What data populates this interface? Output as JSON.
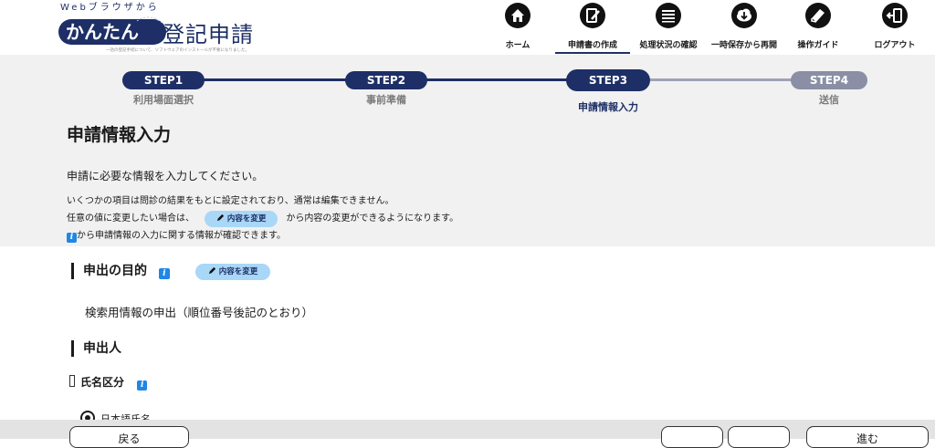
{
  "header": {
    "logo_top": "Webブラウザから",
    "logo_kantan": "かんたん",
    "logo_main": "登記申請",
    "logo_sub": "一括の登記手続について、ソフトウェアのインストールが不要になりました。",
    "nav": [
      {
        "label": "ホーム",
        "icon": "home-icon"
      },
      {
        "label": "申請書の作成",
        "icon": "edit-document-icon"
      },
      {
        "label": "処理状況の確認",
        "icon": "list-status-icon"
      },
      {
        "label": "一時保存から再開",
        "icon": "cloud-download-icon"
      },
      {
        "label": "操作ガイド",
        "icon": "guide-book-icon"
      },
      {
        "label": "ログアウト",
        "icon": "logout-icon"
      }
    ],
    "active_nav": "申請書の作成"
  },
  "steps": [
    {
      "pill": "STEP1",
      "label": "利用場面選択",
      "state": "done"
    },
    {
      "pill": "STEP2",
      "label": "事前準備",
      "state": "done"
    },
    {
      "pill": "STEP3",
      "label": "申請情報入力",
      "state": "current"
    },
    {
      "pill": "STEP4",
      "label": "送信",
      "state": "todo"
    }
  ],
  "page": {
    "title": "申請情報入力",
    "intro1": "申請に必要な情報を入力してください。",
    "intro2": "いくつかの項目は問診の結果をもとに設定されており、通常は編集できません。",
    "intro3_before": "任意の値に変更したい場合は、",
    "intro3_after": "から内容の変更ができるようになります。",
    "intro4": "から申請情報の入力に関する情報が確認できます。",
    "info_glyph": "i",
    "change_button": "内容を変更"
  },
  "sections": {
    "purpose_title": "申出の目的",
    "purpose_value": "検索用情報の申出（順位番号後記のとおり）",
    "applicant_title": "申出人",
    "name_type_label": "氏名区分",
    "radio_japanese": "日本語氏名"
  },
  "footer": {
    "back": "戻る",
    "next": "進む"
  },
  "colors": {
    "navy": "#1d2f66",
    "grey_pill": "#8a8fa6",
    "step_bg": "#f1f1f1",
    "change_btn": "#a9d7f7",
    "info_blue": "#1f87e6"
  }
}
